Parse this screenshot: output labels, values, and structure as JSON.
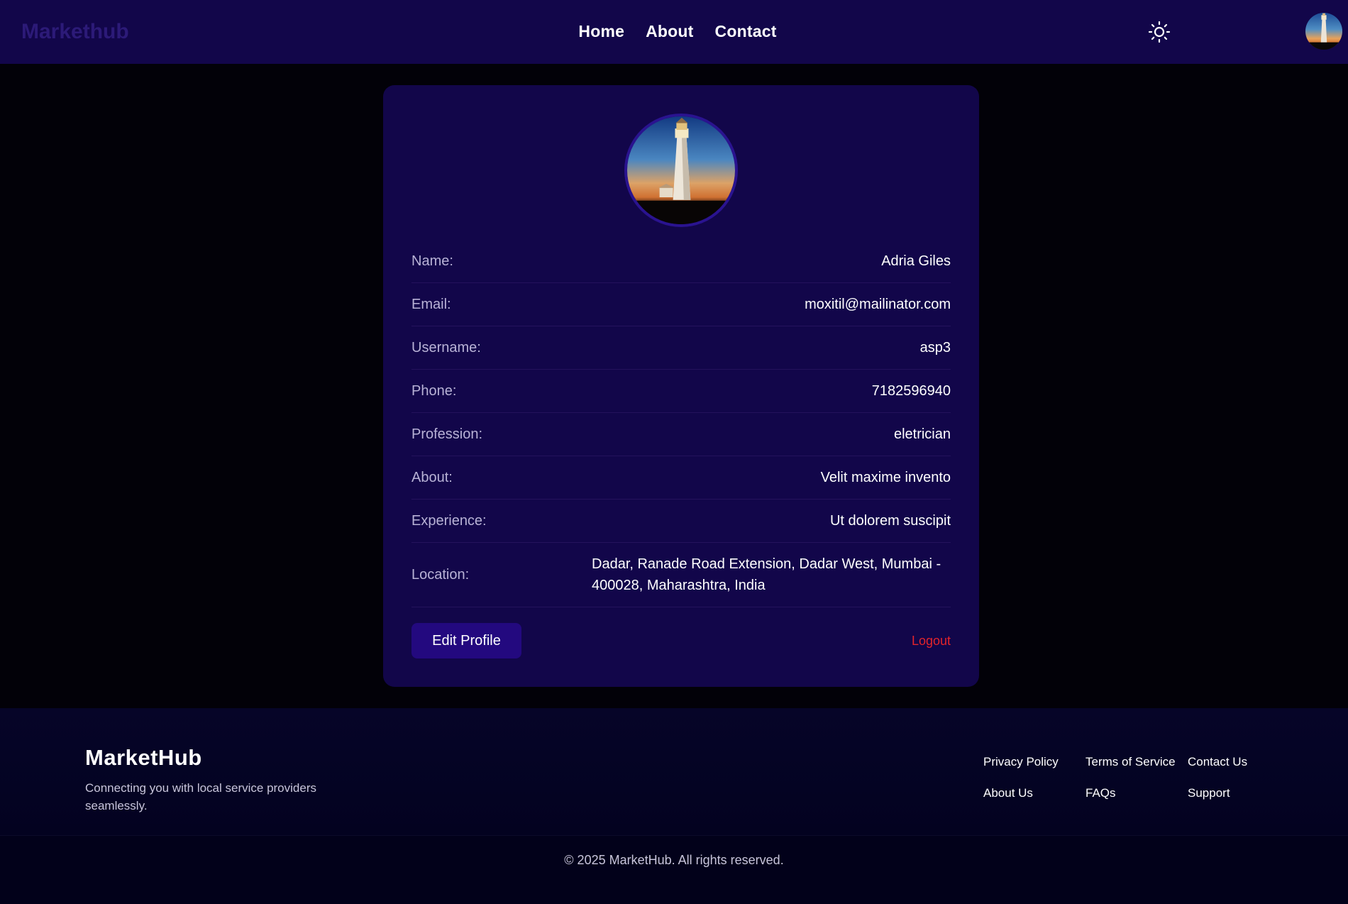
{
  "header": {
    "brand": "Markethub",
    "nav": [
      "Home",
      "About",
      "Contact"
    ],
    "theme_icon": "sun-icon"
  },
  "profile": {
    "fields": [
      {
        "label": "Name:",
        "value": "Adria Giles"
      },
      {
        "label": "Email:",
        "value": "moxitil@mailinator.com"
      },
      {
        "label": "Username:",
        "value": "asp3"
      },
      {
        "label": "Phone:",
        "value": "7182596940"
      },
      {
        "label": "Profession:",
        "value": "eletrician"
      },
      {
        "label": "About:",
        "value": "Velit maxime invento"
      },
      {
        "label": "Experience:",
        "value": "Ut dolorem suscipit"
      },
      {
        "label": "Location:",
        "value": "Dadar, Ranade Road Extension, Dadar West, Mumbai - 400028, Maharashtra, India"
      }
    ],
    "edit_label": "Edit Profile",
    "logout_label": "Logout"
  },
  "footer": {
    "brand": "MarketHub",
    "tagline": "Connecting you with local service providers seamlessly.",
    "links": [
      "Privacy Policy",
      "Terms of Service",
      "Contact Us",
      "About Us",
      "FAQs",
      "Support"
    ],
    "copyright": "© 2025 MarketHub. All rights reserved."
  },
  "colors": {
    "header_bg": "#12064a",
    "card_bg": "#12064a",
    "button_bg": "#23097f",
    "logout": "#e3242b",
    "page_bg": "#020108"
  }
}
